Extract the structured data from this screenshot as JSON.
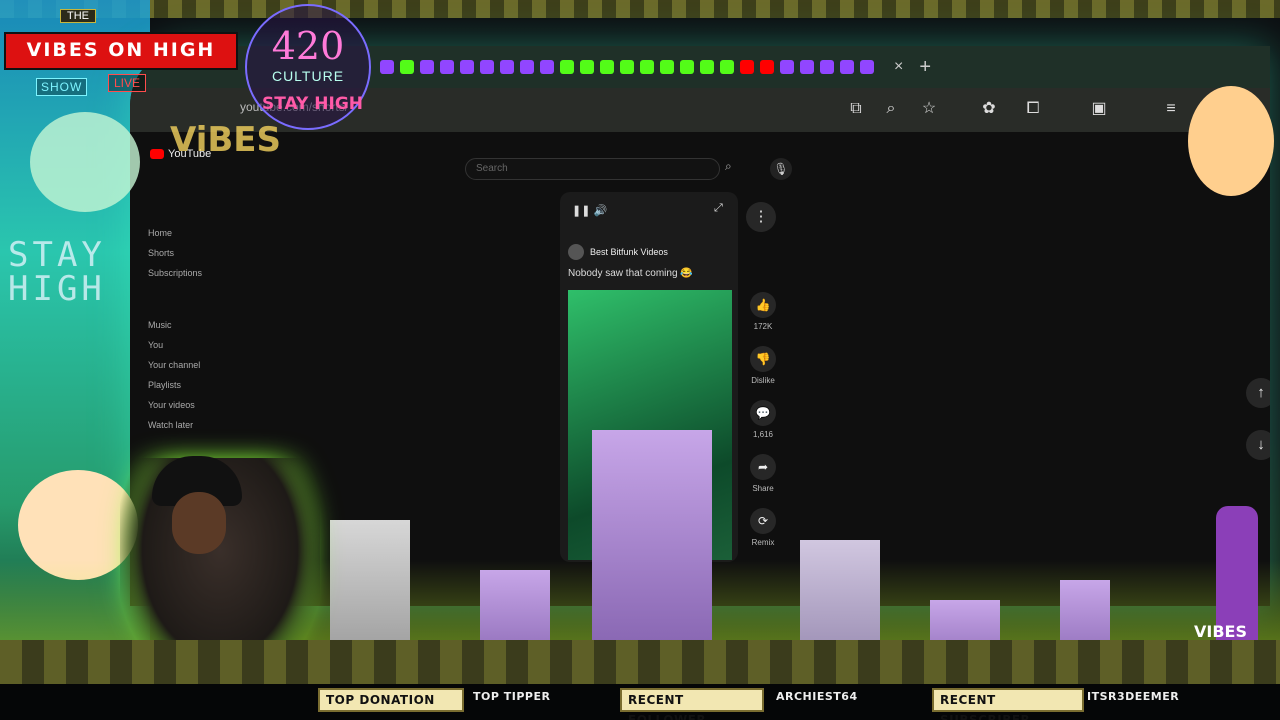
{
  "overlay": {
    "brand_small": "THE",
    "brand_title": "VIBES ON HIGH",
    "brand_show": "SHOW",
    "brand_live": "LIVE",
    "culture_number": "420",
    "culture_word": "CULTURE",
    "stay_high_small": "STAY HIGH",
    "vibes_logo": "ViBES",
    "stay_high_big_line1": "STAY",
    "stay_high_big_line2": "HIGH",
    "bong_label": "VIBES"
  },
  "browser": {
    "address": "youtube.com/shorts/",
    "tab_favicons": [
      "twitch",
      "kick",
      "twitch",
      "twitch",
      "twitch",
      "twitch",
      "twitch",
      "twitch",
      "twitch",
      "kick",
      "kick",
      "kick",
      "kick",
      "kick",
      "kick",
      "kick",
      "kick",
      "kick",
      "youtube",
      "youtube",
      "twitch",
      "twitch",
      "twitch",
      "twitch",
      "twitch"
    ],
    "tab_close": "×",
    "tab_new": "+"
  },
  "youtube": {
    "logo_text": "YouTube",
    "search_placeholder": "Search",
    "sidebar": [
      "Home",
      "Shorts",
      "Subscriptions",
      "",
      "Music",
      "You",
      "Your channel",
      "Playlists",
      "Your videos",
      "Watch later"
    ],
    "short_channel": "Best Bitfunk Videos",
    "short_title": "Nobody saw that coming 😂",
    "actions": [
      {
        "icon": "like-icon",
        "label": "172K"
      },
      {
        "icon": "dislike-icon",
        "label": "Dislike"
      },
      {
        "icon": "comment-icon",
        "label": "1,616"
      },
      {
        "icon": "share-icon",
        "label": "Share"
      },
      {
        "icon": "remix-icon",
        "label": "Remix"
      }
    ]
  },
  "ticker": {
    "top_donation_label": "TOP DONATION",
    "top_donation_value": "",
    "top_tipper_label": "TOP TIPPER",
    "recent_follower_label": "RECENT FOLLOWER",
    "recent_follower_value": "ARCHIEST64",
    "recent_subscriber_label": "RECENT SUBSCRIBER",
    "recent_subscriber_value": "ITSR3DEEMER"
  },
  "colors": {
    "twitch": "#9146ff",
    "kick": "#53fc18",
    "youtube": "#ff0000",
    "brand_red": "#dd1111"
  }
}
